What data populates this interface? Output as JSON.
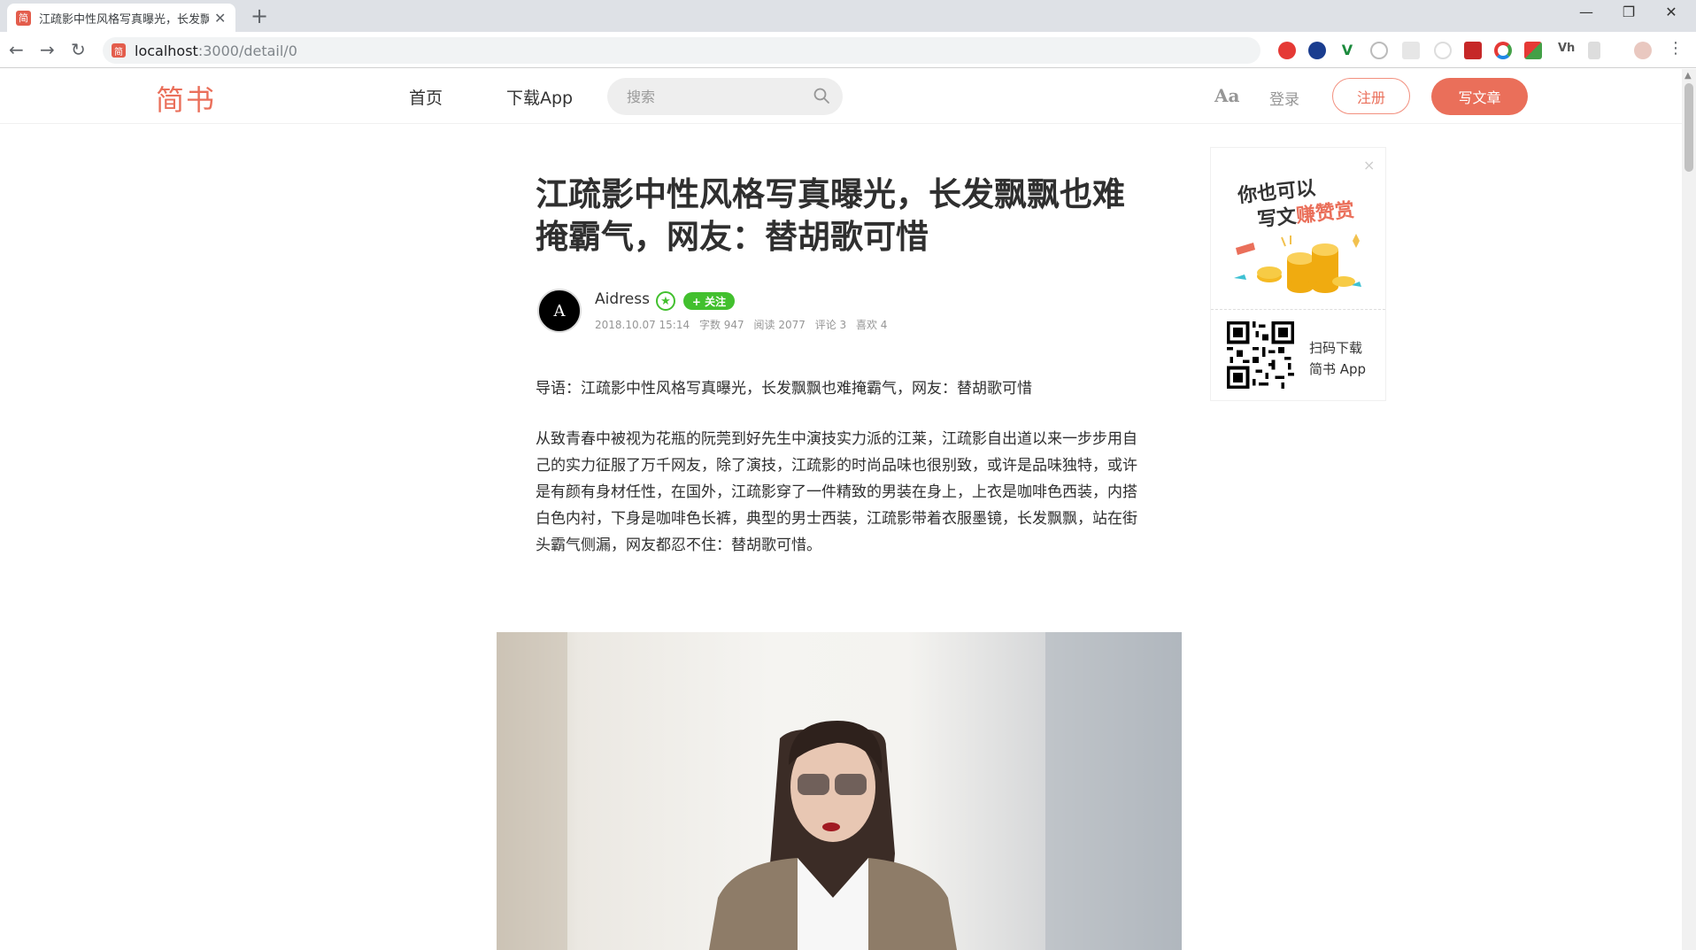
{
  "browser": {
    "tab_title": "江疏影中性风格写真曝光，长发飘飘",
    "favicon_text": "简",
    "url_host": "localhost",
    "url_path": ":3000/detail/0",
    "ext_vh": "Vh"
  },
  "header": {
    "logo": "简书",
    "nav": [
      "首页",
      "下载App"
    ],
    "search_placeholder": "搜索",
    "aa": "Aa",
    "login": "登录",
    "signup": "注册",
    "write": "写文章"
  },
  "article": {
    "title": "江疏影中性风格写真曝光，长发飘飘也难掩霸气，网友：替胡歌可惜",
    "author": "Aidress",
    "avatar_letter": "A",
    "badge": "★",
    "follow": "+ 关注",
    "meta": {
      "date": "2018.10.07 15:14",
      "words": "字数 947",
      "reads": "阅读 2077",
      "comments": "评论 3",
      "likes": "喜欢 4"
    },
    "lead": "导语：江疏影中性风格写真曝光，长发飘飘也难掩霸气，网友：替胡歌可惜",
    "body": "从致青春中被视为花瓶的阮莞到好先生中演技实力派的江莱，江疏影自出道以来一步步用自己的实力征服了万千网友，除了演技，江疏影的时尚品味也很别致，或许是品味独特，或许是有颜有身材任性，在国外，江疏影穿了一件精致的男装在身上，上衣是咖啡色西装，内搭白色内衬，下身是咖啡色长裤，典型的男士西装，江疏影带着衣服墨镜，长发飘飘，站在街头霸气侧漏，网友都忍不住：替胡歌可惜。"
  },
  "ad": {
    "close": "×",
    "line1": "你也可以",
    "line2_prefix": "写文",
    "line2_highlight": "赚赞赏",
    "download_line1": "扫码下载",
    "download_line2": "简书 App"
  },
  "colors": {
    "brand": "#ea6f5a",
    "follow_green": "#42c02e"
  }
}
